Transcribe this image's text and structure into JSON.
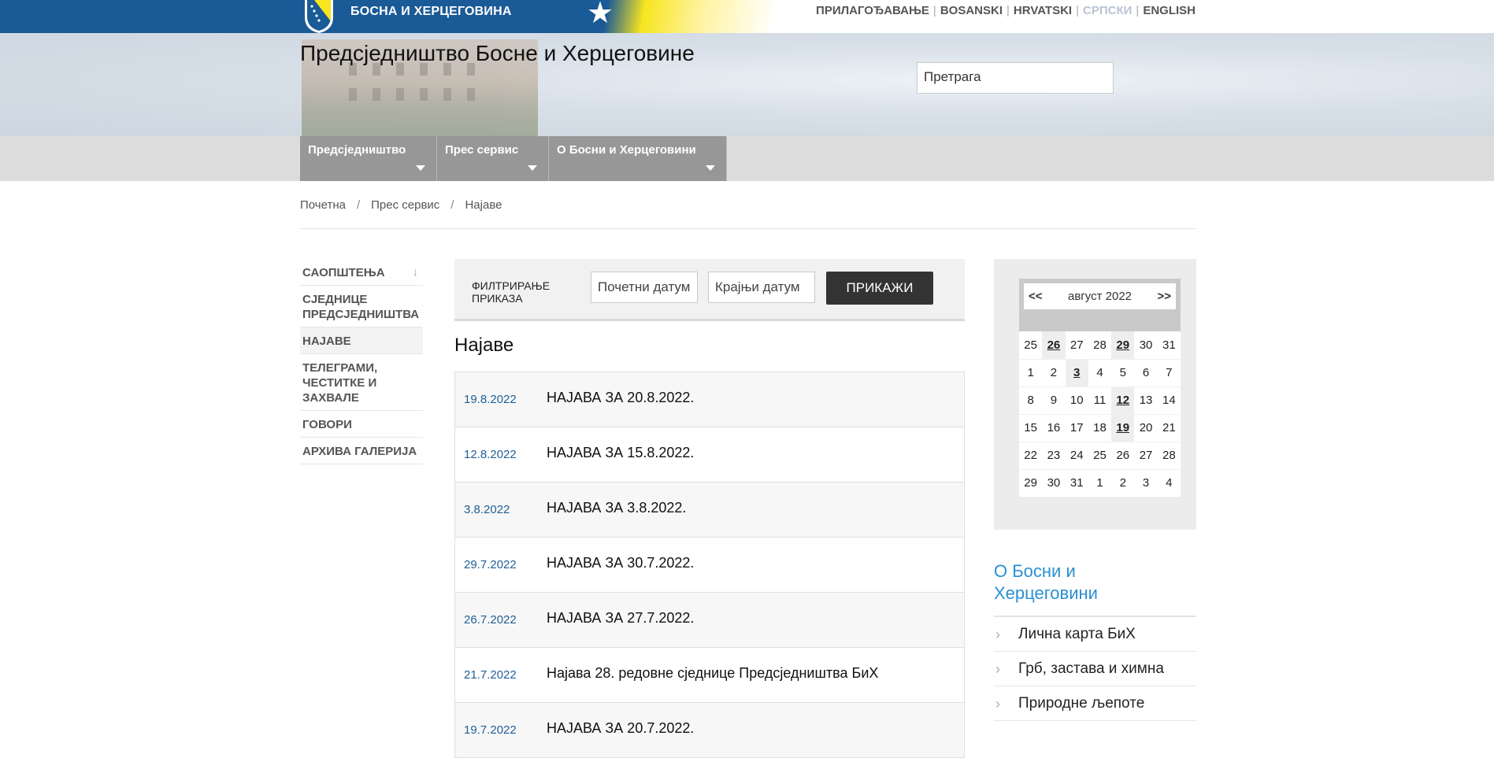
{
  "topbar": {
    "country": "БОСНА И ХЕРЦЕГОВИНА",
    "languages": [
      "ПРИЛАГОЂАВАЊЕ",
      "BOSANSKI",
      "HRVATSKI",
      "СРПСКИ",
      "ENGLISH"
    ]
  },
  "header": {
    "title": "Предсједништво Босне и Херцеговине",
    "search_value": "Претрага"
  },
  "nav": [
    "Предсједништво",
    "Прес сервис",
    "О Босни и Херцеговини"
  ],
  "breadcrumb": [
    "Почетна",
    "Прес сервис",
    "Најаве"
  ],
  "left_menu": [
    "САОПШТЕЊА",
    "СЈЕДНИЦЕ ПРЕДСЈЕДНИШТВА",
    "НАЈАВЕ",
    "ТЕЛЕГРАМИ, ЧЕСТИТКЕ И ЗАХВАЛЕ",
    "ГОВОРИ",
    "АРХИВА ГАЛЕРИЈА"
  ],
  "filter": {
    "label": "ФИЛТРИРАЊЕ ПРИКАЗА",
    "start_placeholder": "Почетни датум",
    "end_placeholder": "Крајњи датум",
    "button": "ПРИКАЖИ"
  },
  "list": {
    "title": "Најаве",
    "rows": [
      {
        "date": "19.8.2022",
        "title": "НАЈАВА ЗА 20.8.2022."
      },
      {
        "date": "12.8.2022",
        "title": "НАЈАВА ЗА 15.8.2022."
      },
      {
        "date": "3.8.2022",
        "title": "НАЈАВА ЗА 3.8.2022."
      },
      {
        "date": "29.7.2022",
        "title": "НАЈАВА ЗА 30.7.2022."
      },
      {
        "date": "26.7.2022",
        "title": "НАЈАВА ЗА 27.7.2022."
      },
      {
        "date": "21.7.2022",
        "title": "Најава 28. редовне сједнице Предсједништва БиХ"
      },
      {
        "date": "19.7.2022",
        "title": "НАЈАВА ЗА 20.7.2022."
      }
    ]
  },
  "calendar": {
    "prev": "<<",
    "next": ">>",
    "month": "август 2022",
    "weeks": [
      [
        "25",
        "26",
        "27",
        "28",
        "29",
        "30",
        "31"
      ],
      [
        "1",
        "2",
        "3",
        "4",
        "5",
        "6",
        "7"
      ],
      [
        "8",
        "9",
        "10",
        "11",
        "12",
        "13",
        "14"
      ],
      [
        "15",
        "16",
        "17",
        "18",
        "19",
        "20",
        "21"
      ],
      [
        "22",
        "23",
        "24",
        "25",
        "26",
        "27",
        "28"
      ],
      [
        "29",
        "30",
        "31",
        "1",
        "2",
        "3",
        "4"
      ]
    ],
    "highlighted": [
      "0-1",
      "0-4",
      "1-2",
      "2-4",
      "3-4"
    ]
  },
  "about": {
    "title": "О Босни и Херцеговини",
    "items": [
      "Лична карта БиХ",
      "Грб, застава и химна",
      "Природне љепоте"
    ]
  },
  "icons": {
    "crest": "coat-of-arms",
    "nav_arrow": "caret-down-icon",
    "menu_down": "arrow-down-icon",
    "about_bullet": "chevron-right-icon"
  },
  "colors": {
    "topbar": "#1a5a96",
    "flag_yellow": "#f7e51f",
    "link_blue": "#1f5f96",
    "about_title": "#2a8fd2",
    "button_dark": "#333333",
    "nav_gray": "#979797"
  }
}
